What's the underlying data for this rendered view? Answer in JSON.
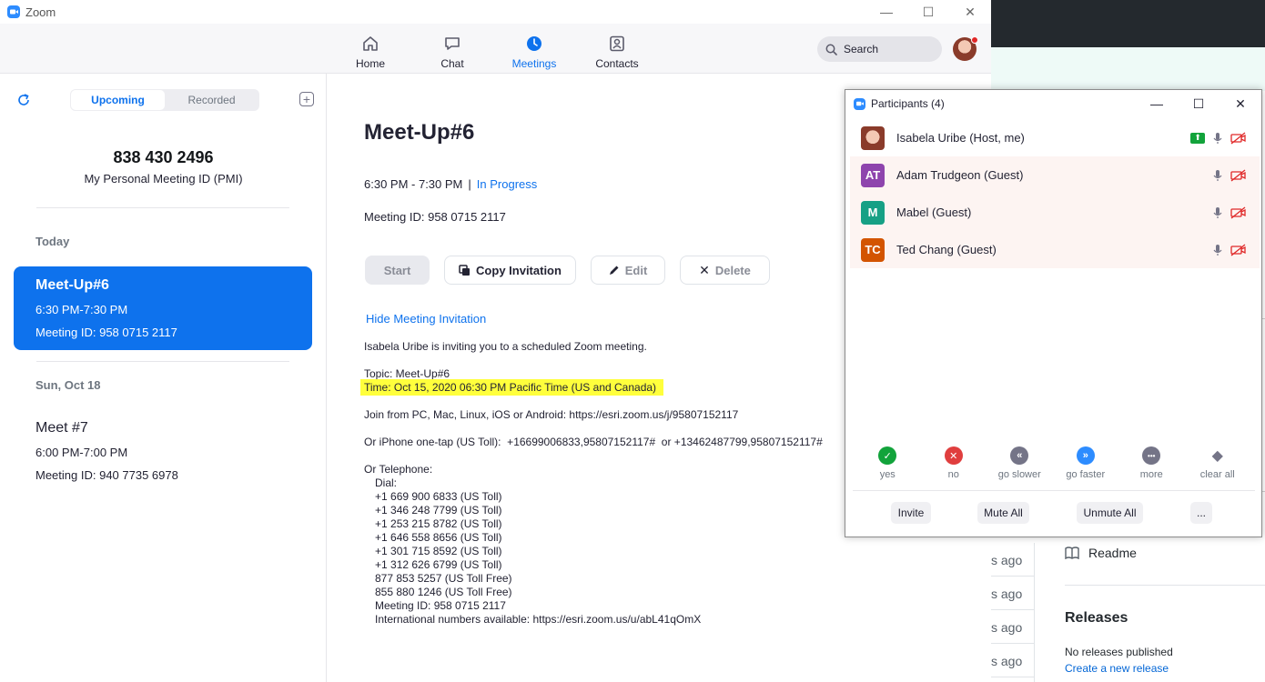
{
  "app": {
    "title": "Zoom"
  },
  "nav": {
    "items": [
      {
        "label": "Home"
      },
      {
        "label": "Chat"
      },
      {
        "label": "Meetings"
      },
      {
        "label": "Contacts"
      }
    ],
    "active": "Meetings",
    "search_placeholder": "Search"
  },
  "sidebar": {
    "tabs": [
      "Upcoming",
      "Recorded"
    ],
    "active_tab": "Upcoming",
    "pmi_number": "838 430 2496",
    "pmi_label": "My Personal Meeting ID (PMI)",
    "groups": [
      {
        "day": "Today",
        "meetings": [
          {
            "title": "Meet-Up#6",
            "time": "6:30 PM-7:30 PM",
            "id": "Meeting ID: 958 0715 2117",
            "selected": true
          }
        ]
      },
      {
        "day": "Sun, Oct 18",
        "meetings": [
          {
            "title": "Meet #7",
            "time": "6:00 PM-7:00 PM",
            "id": "Meeting ID: 940 7735 6978",
            "selected": false
          }
        ]
      }
    ]
  },
  "detail": {
    "title": "Meet-Up#6",
    "time_range": "6:30 PM - 7:30 PM",
    "separator": "|",
    "status": "In Progress",
    "meeting_id": "Meeting ID: 958 0715 2117",
    "buttons": {
      "start": "Start",
      "copy": "Copy Invitation",
      "edit": "Edit",
      "delete": "Delete"
    },
    "hide_link": "Hide Meeting Invitation",
    "invitation": {
      "intro": "Isabela Uribe is inviting you to a scheduled Zoom meeting.",
      "topic": "Topic: Meet-Up#6",
      "time": "Time: Oct 15, 2020 06:30 PM Pacific Time (US and Canada)",
      "join": "Join from PC, Mac, Linux, iOS or Android: https://esri.zoom.us/j/95807152117",
      "iphone": "Or iPhone one-tap (US Toll):  +16699006833,95807152117#  or +13462487799,95807152117#",
      "telephone": "Or Telephone:",
      "dial": "Dial:",
      "numbers": [
        "+1 669 900 6833 (US Toll)",
        "+1 346 248 7799 (US Toll)",
        "+1 253 215 8782 (US Toll)",
        "+1 646 558 8656 (US Toll)",
        "+1 301 715 8592 (US Toll)",
        "+1 312 626 6799 (US Toll)",
        "877 853 5257 (US Toll Free)",
        "855 880 1246 (US Toll Free)"
      ],
      "meeting_id": "Meeting ID: 958 0715 2117",
      "international": "International numbers available: https://esri.zoom.us/u/abL41qOmX"
    }
  },
  "participants": {
    "title": "Participants (4)",
    "list": [
      {
        "initials": "",
        "name": "Isabela Uribe (Host, me)",
        "color": "#d98d6b",
        "role": "host"
      },
      {
        "initials": "AT",
        "name": "Adam Trudgeon (Guest)",
        "color": "#8e44ad",
        "role": "guest"
      },
      {
        "initials": "M",
        "name": "Mabel (Guest)",
        "color": "#16a085",
        "role": "guest"
      },
      {
        "initials": "TC",
        "name": "Ted Chang (Guest)",
        "color": "#d35400",
        "role": "guest"
      }
    ],
    "reactions": [
      {
        "label": "yes",
        "color": "#12a33b",
        "glyph": "✓"
      },
      {
        "label": "no",
        "color": "#e03e3e",
        "glyph": "✕"
      },
      {
        "label": "go slower",
        "color": "#747487",
        "glyph": "«"
      },
      {
        "label": "go faster",
        "color": "#2d8cff",
        "glyph": "»"
      },
      {
        "label": "more",
        "color": "#747487",
        "glyph": "•••"
      },
      {
        "label": "clear all",
        "color": "#747487",
        "glyph": "◆"
      }
    ],
    "buttons": {
      "invite": "Invite",
      "mute_all": "Mute All",
      "unmute_all": "Unmute All",
      "more": "..."
    }
  },
  "background": {
    "ago": [
      "s ago",
      "s ago",
      "s ago",
      "s ago"
    ],
    "readme": "Readme",
    "releases": "Releases",
    "no_releases": "No releases published",
    "create_release": "Create a new release"
  }
}
